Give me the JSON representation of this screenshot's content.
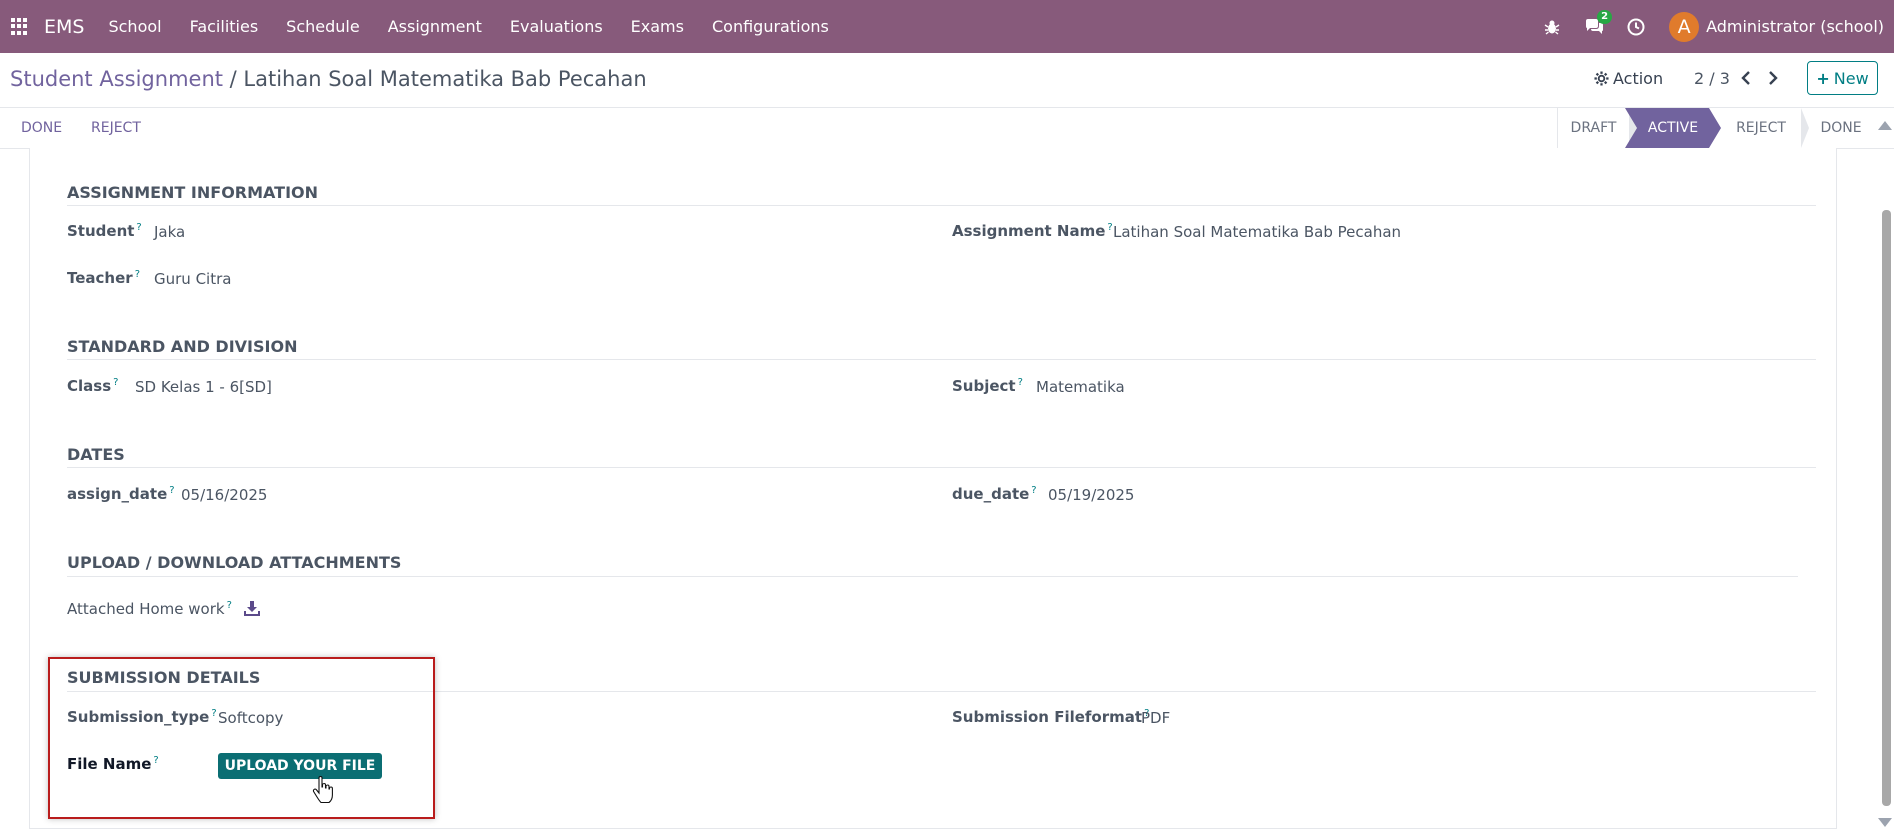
{
  "navbar": {
    "brand": "EMS",
    "menu": [
      "School",
      "Facilities",
      "Schedule",
      "Assignment",
      "Evaluations",
      "Exams",
      "Configurations"
    ],
    "messages_badge": "2",
    "avatar_letter": "A",
    "user": "Administrator (school)"
  },
  "control": {
    "breadcrumb_parent": "Student Assignment",
    "breadcrumb_sep": " / ",
    "breadcrumb_current": "Latihan Soal Matematika Bab Pecahan",
    "action_label": "Action",
    "pager": "2 / 3",
    "new_label": "New"
  },
  "statusbar": {
    "done_btn": "DONE",
    "reject_btn": "REJECT",
    "stages": [
      "DRAFT",
      "ACTIVE",
      "REJECT",
      "DONE"
    ],
    "active_stage": "ACTIVE"
  },
  "form": {
    "assignment_info": {
      "title": "ASSIGNMENT INFORMATION",
      "student_label": "Student",
      "student": "Jaka",
      "teacher_label": "Teacher",
      "teacher": "Guru Citra",
      "assignment_name_label": "Assignment Name",
      "assignment_name": "Latihan Soal Matematika Bab Pecahan"
    },
    "standard": {
      "title": "STANDARD AND DIVISION",
      "class_label": "Class",
      "class": "SD Kelas 1 - 6[SD]",
      "subject_label": "Subject",
      "subject": "Matematika"
    },
    "dates": {
      "title": "DATES",
      "assign_date_label": "assign_date",
      "assign_date": "05/16/2025",
      "due_date_label": "due_date",
      "due_date": "05/19/2025"
    },
    "attachments": {
      "title": "UPLOAD / DOWNLOAD ATTACHMENTS",
      "homework_label": "Attached Home work"
    },
    "submission": {
      "title": "SUBMISSION DETAILS",
      "type_label": "Submission_type",
      "type": "Softcopy",
      "fileformat_label": "Submission Fileformat",
      "fileformat": "PDF",
      "filename_label": "File Name",
      "upload_label": "UPLOAD YOUR FILE"
    },
    "help_mark": "?"
  },
  "colors": {
    "navbar": "#875a7b",
    "primary": "#71639e",
    "teal": "#017e84",
    "highlight": "#b91c1c"
  }
}
